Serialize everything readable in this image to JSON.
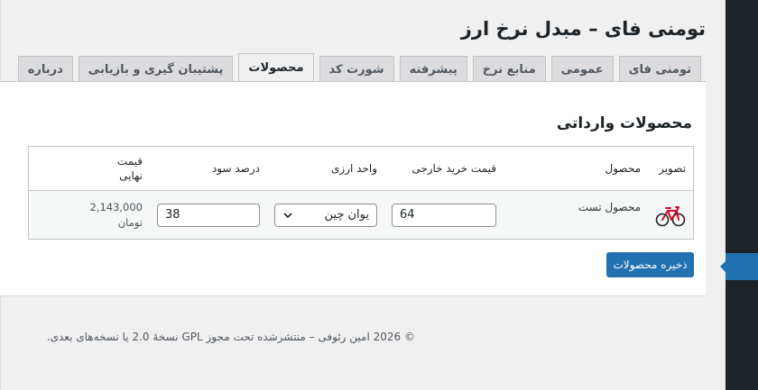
{
  "page": {
    "title": "تومنی فای – مبدل نرخ ارز"
  },
  "tabs": [
    {
      "label": "تومنی فای"
    },
    {
      "label": "عمومی"
    },
    {
      "label": "منابع نرخ"
    },
    {
      "label": "پیشرفته"
    },
    {
      "label": "شورت کد"
    },
    {
      "label": "محصولات",
      "active": true
    },
    {
      "label": "پشتیبان گیری و بازیابی"
    },
    {
      "label": "درباره"
    }
  ],
  "section": {
    "title": "محصولات وارداتی"
  },
  "table": {
    "headers": {
      "image": "تصویر",
      "product": "محصول",
      "foreign_price": "قیمت خرید خارجی",
      "currency": "واحد ارزی",
      "profit": "درصد سود",
      "final_price_line1": "قیمت",
      "final_price_line2": "نهایی"
    },
    "rows": [
      {
        "image_icon": "bicycle-icon",
        "product_name": "محصول تست",
        "foreign_price": "64",
        "currency": "یوان چین",
        "profit_percent": "38",
        "final_price": "2,143,000",
        "final_unit": "تومان"
      }
    ]
  },
  "buttons": {
    "save": "ذخیره محصولات"
  },
  "footer": {
    "text": "© 2026 امین رئوفی – منتشرشده تحت مجوز GPL نسخهٔ 2.0 یا نسخه‌های بعدی."
  },
  "colors": {
    "primary": "#2271b1",
    "admin_bar": "#1d2327",
    "background": "#f0f0f1",
    "bike": "#c8102e"
  }
}
